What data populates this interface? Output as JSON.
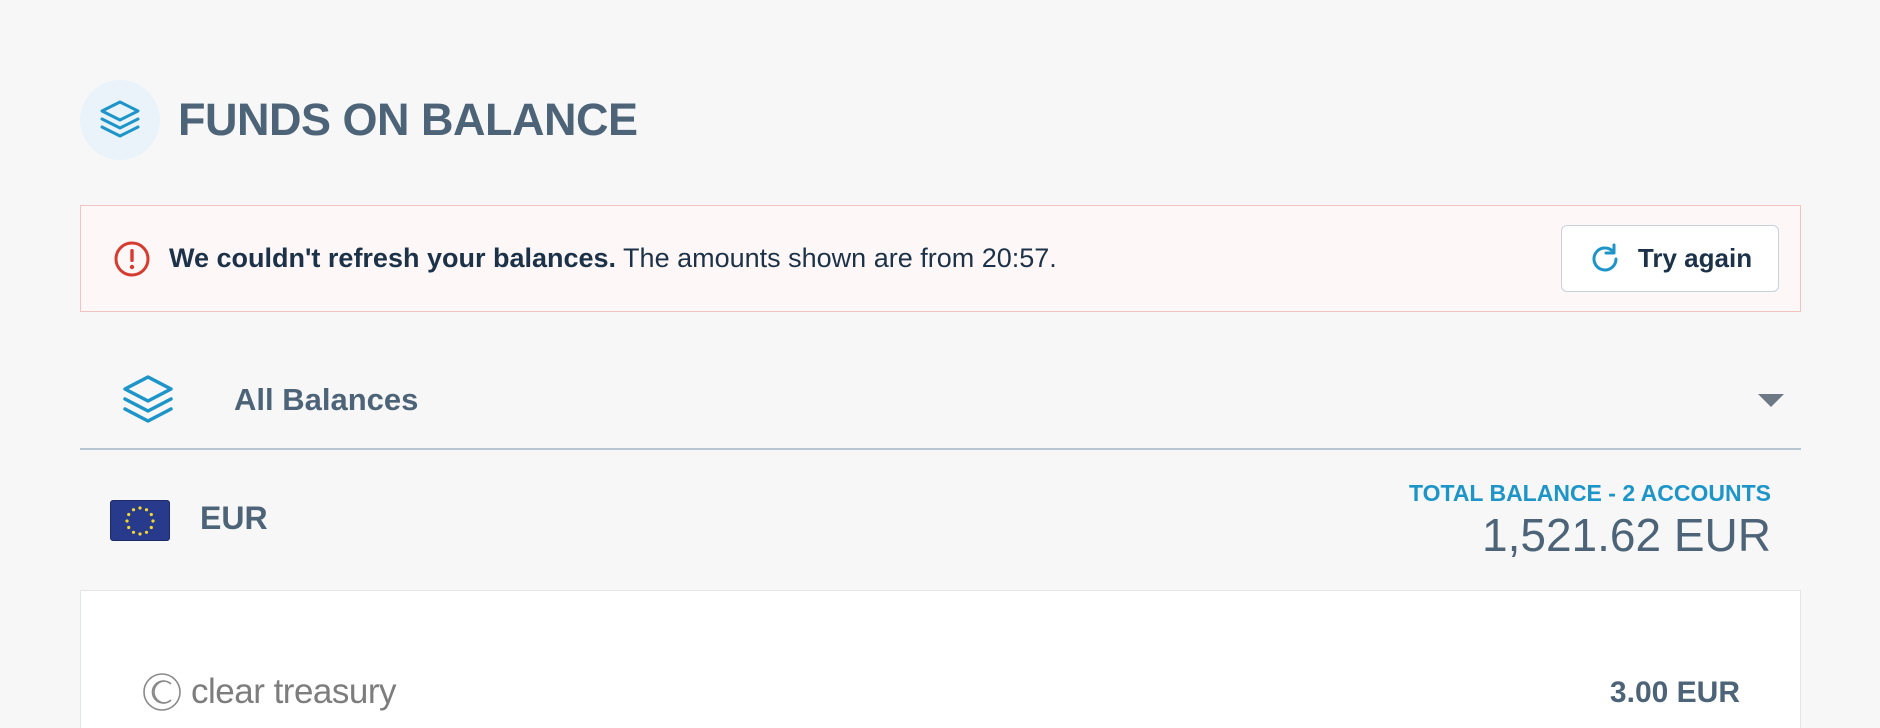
{
  "header": {
    "icon": "layers-icon",
    "title": "FUNDS ON BALANCE"
  },
  "alert": {
    "icon": "exclamation-circle-icon",
    "bold_text": "We couldn't refresh your balances.",
    "text": " The amounts shown are from 20:57.",
    "button_icon": "refresh-icon",
    "button_label": "Try again"
  },
  "balances_select": {
    "icon": "layers-icon",
    "selected": "All Balances",
    "caret_icon": "caret-down-icon"
  },
  "currency": {
    "flag_icon": "eu-flag-icon",
    "code": "EUR",
    "total_caption": "TOTAL BALANCE - 2 ACCOUNTS",
    "total_amount": "1,521.62 EUR"
  },
  "accounts": [
    {
      "logo_text": "clear treasury",
      "amount": "3.00 EUR"
    }
  ],
  "colors": {
    "accent": "#1d95c9",
    "error": "#d63b30",
    "title": "#4d6478",
    "text": "#1c3248"
  }
}
